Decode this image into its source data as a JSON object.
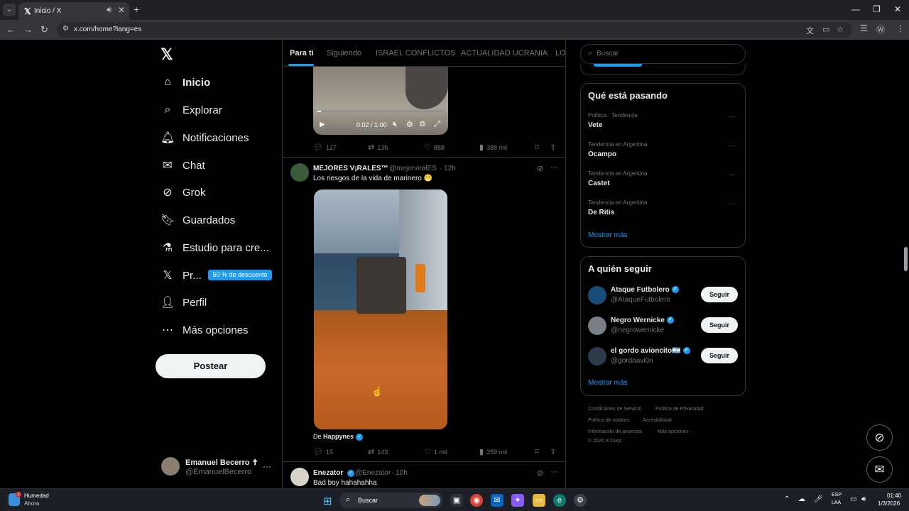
{
  "browser": {
    "tab_title": "Inicio / X",
    "tab_favicon": "𝕏",
    "url": "x.com/home?lang=es",
    "icons": [
      "tab-list-icon",
      "audio-icon",
      "close-icon",
      "new-tab-icon",
      "minimize-icon",
      "restore-icon",
      "window-close-icon",
      "back-icon",
      "forward-icon",
      "reload-icon",
      "site-info-icon",
      "translate-icon",
      "cast-icon",
      "star-icon",
      "reading-list-icon",
      "extension-icon",
      "menu-icon"
    ]
  },
  "nav": {
    "logo": "𝕏",
    "items": [
      {
        "label": "Inicio",
        "icon": "home-icon",
        "glyph": "⌂"
      },
      {
        "label": "Explorar",
        "icon": "search-icon",
        "glyph": "⌕"
      },
      {
        "label": "Notificaciones",
        "icon": "bell-icon",
        "glyph": "🔔︎"
      },
      {
        "label": "Chat",
        "icon": "mail-icon",
        "glyph": "✉"
      },
      {
        "label": "Grok",
        "icon": "grok-icon",
        "glyph": "⊘"
      },
      {
        "label": "Guardados",
        "icon": "bookmark-icon",
        "glyph": "🔖︎"
      },
      {
        "label": "Estudio para cre...",
        "icon": "flask-icon",
        "glyph": "⚗"
      },
      {
        "label": "Pr...",
        "icon": "x-premium-icon",
        "glyph": "𝕏"
      },
      {
        "label": "Perfil",
        "icon": "person-icon",
        "glyph": "👤︎"
      },
      {
        "label": "Más opciones",
        "icon": "more-circle-icon",
        "glyph": "⋯"
      }
    ],
    "premium_badge": "50 % de descuento",
    "post_button": "Postear",
    "account": {
      "name": "Emanuel Becerro ✝",
      "handle": "@EmanuelBecerro",
      "more": "···"
    }
  },
  "feed": {
    "tabs": [
      "Para ti",
      "Siguiendo",
      "ISRAEL CONFLICTOS",
      "ACTUALIDAD UCRANIA",
      "LO"
    ],
    "video1": {
      "time": "0:02 / 1:00",
      "progress": 0.03
    },
    "post1_actions": {
      "replies": "127",
      "reposts": "136",
      "likes": "888",
      "views": "388 mil"
    },
    "post2": {
      "name": "MEJORES V¡RALES™",
      "handle": "@mejorviralES",
      "time": "· 12h",
      "text": "Los riesgos de la vida de marinero 😬",
      "source_prefix": "De",
      "source_name": "Happynes",
      "actions": {
        "replies": "15",
        "reposts": "143",
        "likes": "1 mil",
        "views": "259 mil"
      }
    },
    "post3": {
      "name": "Enezator",
      "handle": "@Enezator",
      "time": "· 10h",
      "text": "Bad boy hahahahha"
    }
  },
  "sidebar": {
    "search_placeholder": "Buscar",
    "trends_title": "Qué está pasando",
    "trends": [
      {
        "context": "Política · Tendencia",
        "name": "Vete"
      },
      {
        "context": "Tendencia en Argentina",
        "name": "Ocampo"
      },
      {
        "context": "Tendencia en Argentina",
        "name": "Castet"
      },
      {
        "context": "Tendencia en Argentina",
        "name": "De Ritis"
      }
    ],
    "trends_more": "Mostrar más",
    "follow_title": "A quién seguir",
    "follow": [
      {
        "name": "Ataque Futbolero",
        "handle": "@AtaqueFutbolero",
        "button": "Seguir"
      },
      {
        "name": "Negro Wernicke",
        "handle": "@negrowernicke",
        "button": "Seguir"
      },
      {
        "name": "el gordo avioncito🇦🇷",
        "handle": "@gordoavi0n",
        "button": "Seguir"
      }
    ],
    "follow_more": "Mostrar más",
    "footer": {
      "terms": "Condiciones de Servicio",
      "privacy": "Política de Privacidad",
      "cookies": "Política de cookies",
      "accessibility": "Accesibilidad",
      "ads": "Información de anuncios",
      "more": "Más opciones ···",
      "copyright": "© 2026 X Corp."
    }
  },
  "taskbar": {
    "weather_label": "Humedad",
    "weather_sub": "Ahora",
    "weather_badge": "1",
    "search_label": "Buscar",
    "lang_line1": "ESP",
    "lang_line2": "LAA",
    "time": "01:40",
    "date": "1/3/2026"
  },
  "colors": {
    "accent": "#1d9bf0",
    "background": "#000000",
    "border": "#2f3336",
    "muted": "#71767b"
  }
}
